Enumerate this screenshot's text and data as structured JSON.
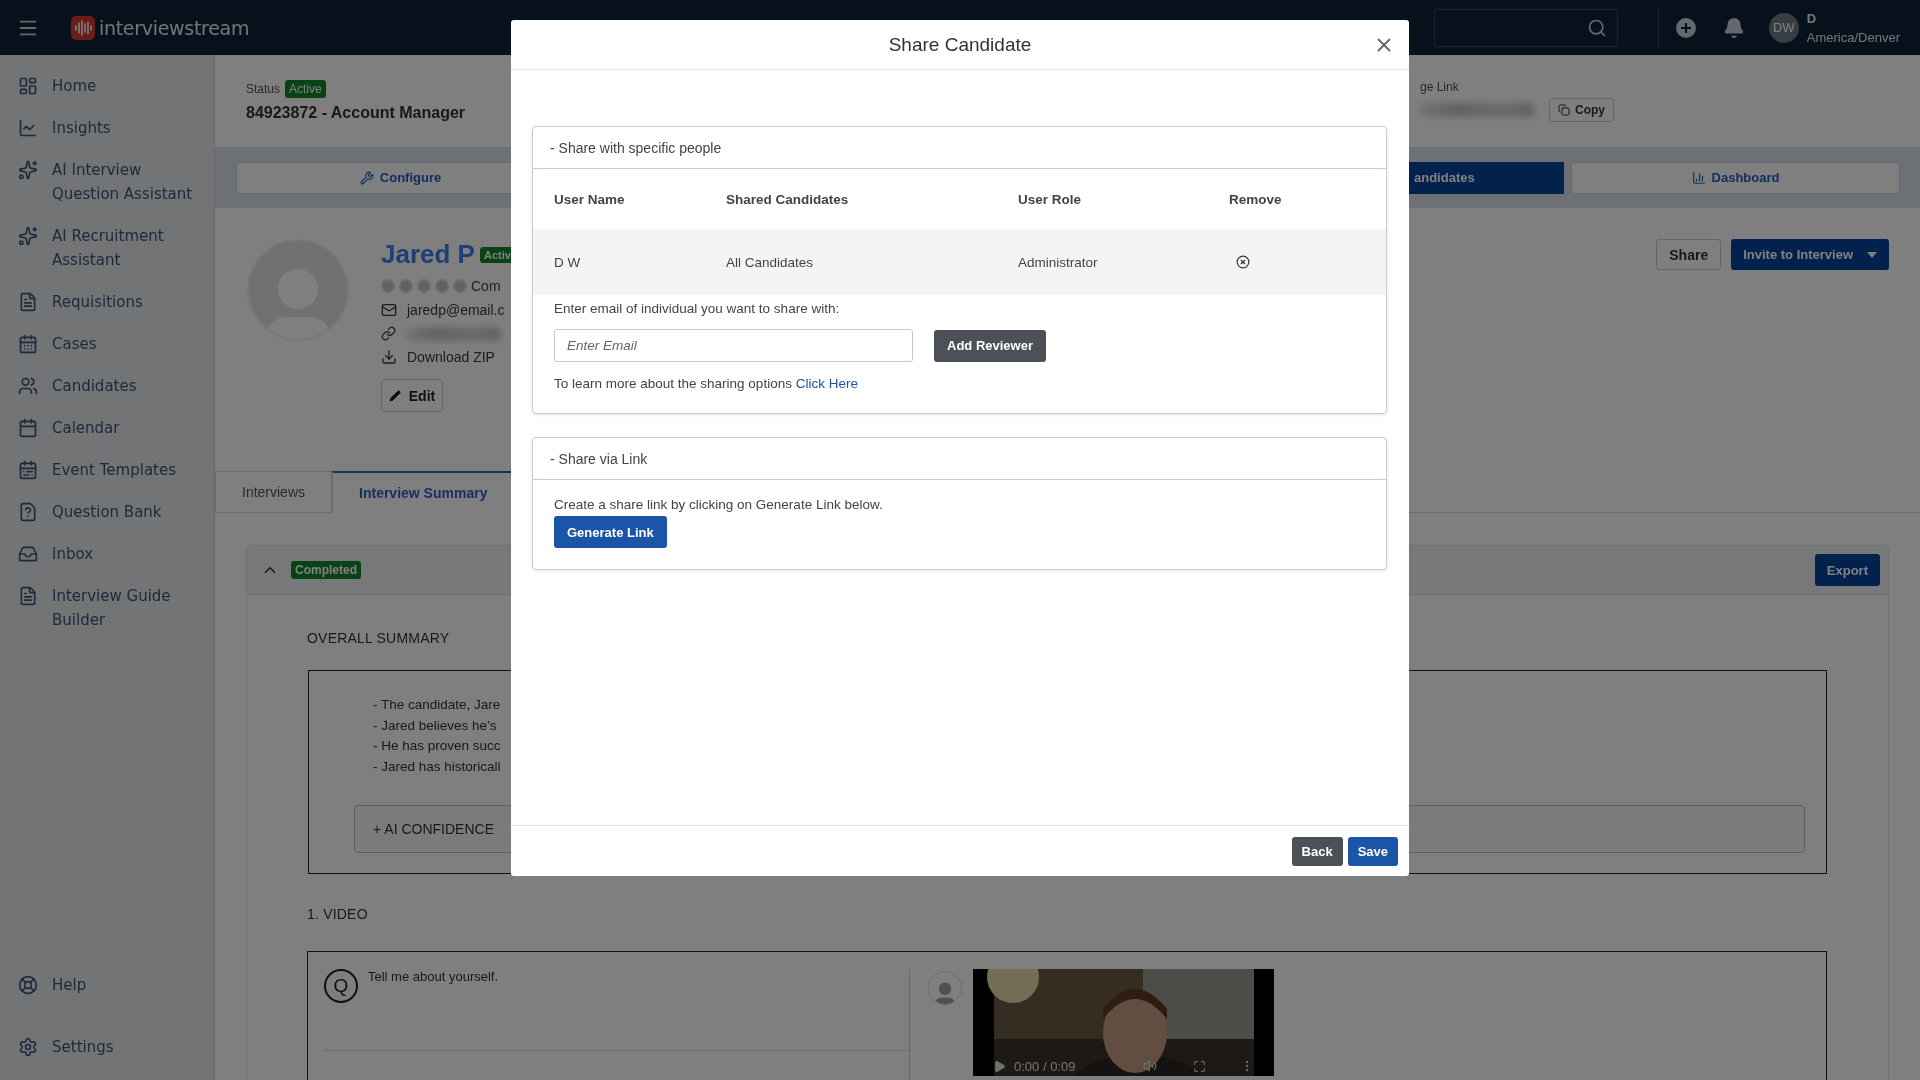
{
  "header": {
    "brand": "interviewstream",
    "user": {
      "initials": "DW",
      "name": "D",
      "timezone": "America/Denver"
    }
  },
  "sidebar": {
    "items": [
      {
        "label": "Home"
      },
      {
        "label": "Insights"
      },
      {
        "label": "AI Interview Question Assistant"
      },
      {
        "label": "AI Recruitment Assistant"
      },
      {
        "label": "Requisitions"
      },
      {
        "label": "Cases"
      },
      {
        "label": "Candidates"
      },
      {
        "label": "Calendar"
      },
      {
        "label": "Event Templates"
      },
      {
        "label": "Question Bank"
      },
      {
        "label": "Inbox"
      },
      {
        "label": "Interview Guide Builder"
      }
    ],
    "footer_items": [
      {
        "label": "Help"
      },
      {
        "label": "Settings"
      }
    ]
  },
  "requisition": {
    "status_label": "Status",
    "status": "Active",
    "title": "84923872 - Account Manager",
    "link_label": "ge Link",
    "copy_button": "Copy"
  },
  "nav_tabs": [
    {
      "label": "Configure",
      "selected": false
    },
    {
      "label": "andidates",
      "selected": true
    },
    {
      "label": "Dashboard",
      "selected": false
    }
  ],
  "candidate": {
    "name": "Jared P",
    "status": "Activ",
    "stars": 0,
    "rating_label": "Com",
    "email": "jaredp@email.c",
    "download": "Download ZIP",
    "edit_button": "Edit"
  },
  "actions": {
    "share_button": "Share",
    "invite_button": "Invite to Interview"
  },
  "content_tabs": [
    {
      "label": "Interviews",
      "selected": false
    },
    {
      "label": "Interview Summary",
      "selected": true
    }
  ],
  "interview": {
    "status": "Completed",
    "expanded": true,
    "export_button": "Export",
    "summary_heading": "OVERALL SUMMARY",
    "summary_lines": [
      "- The candidate, Jare",
      "- Jared believes he’s",
      "- He has proven succ",
      "- Jared has historicall"
    ],
    "confidence_toggle": "+ AI CONFIDENCE",
    "questions": [
      {
        "heading": "1. VIDEO",
        "marker": "Q",
        "prompt": "Tell me about yourself.",
        "video_time": "0:00 / 0:09"
      }
    ]
  },
  "modal": {
    "title": "Share Candidate",
    "people_section": {
      "title": "- Share with specific people",
      "columns": [
        "User Name",
        "Shared Candidates",
        "User Role",
        "Remove"
      ],
      "rows": [
        {
          "user_name": "D W",
          "shared_candidates": "All Candidates",
          "user_role": "Administrator"
        }
      ],
      "email_prompt": "Enter email of individual you want to share with:",
      "email_placeholder": "Enter Email",
      "add_button": "Add Reviewer",
      "help_text": "To learn more about the sharing options",
      "help_link": "Click Here"
    },
    "link_section": {
      "title": "- Share via Link",
      "text": "Create a share link by clicking on Generate Link below.",
      "button": "Generate Link"
    },
    "footer_buttons": [
      {
        "label": "Back",
        "kind": "secondary"
      },
      {
        "label": "Save",
        "kind": "primary"
      }
    ]
  }
}
